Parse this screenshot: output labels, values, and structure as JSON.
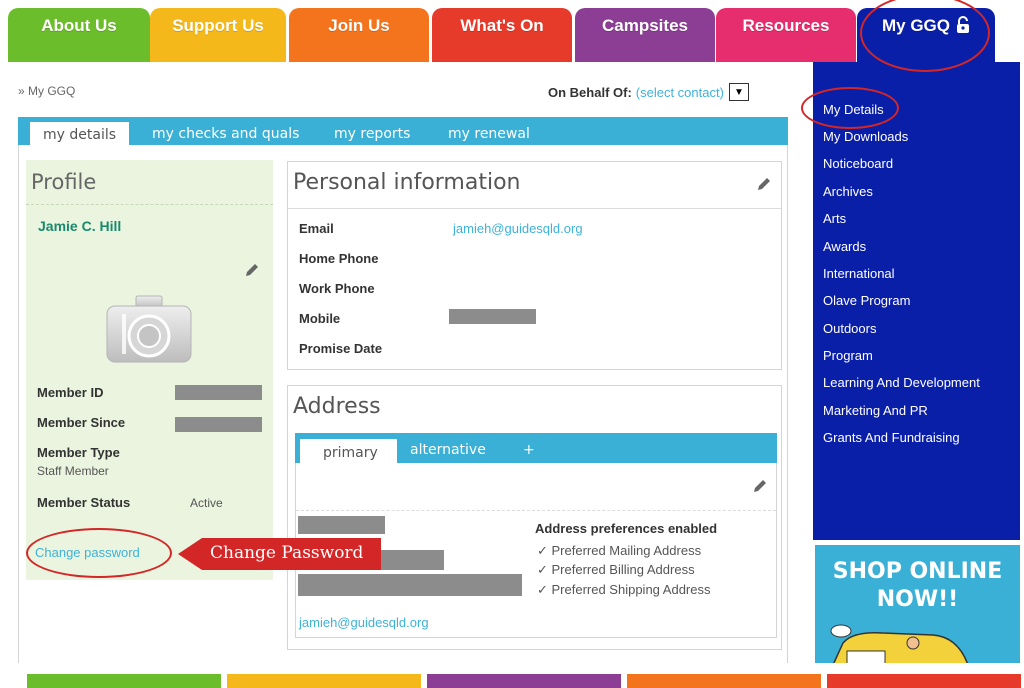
{
  "topnav": {
    "tabs": [
      {
        "label": "About Us",
        "color": "#6cbd2c"
      },
      {
        "label": "Support Us",
        "color": "#f5b81b"
      },
      {
        "label": "Join Us",
        "color": "#f3741d"
      },
      {
        "label": "What's On",
        "color": "#e63a2b"
      },
      {
        "label": "Campsites",
        "color": "#8b3e93"
      },
      {
        "label": "Resources",
        "color": "#e62d6d"
      },
      {
        "label": "My GGQ",
        "color": "#0a1fa8",
        "icon": "unlock-icon"
      }
    ]
  },
  "breadcrumb": "» My GGQ",
  "behalf": {
    "label": "On Behalf Of:",
    "link": "(select contact)"
  },
  "main_tabs": [
    "my details",
    "my checks and quals",
    "my reports",
    "my renewal"
  ],
  "profile": {
    "heading": "Profile",
    "name": "Jamie C. Hill",
    "fields": {
      "member_id": "Member ID",
      "member_since": "Member Since",
      "member_type": "Member Type",
      "member_type_value": "Staff Member",
      "member_status": "Member Status",
      "member_status_value": "Active"
    },
    "change_password": "Change password"
  },
  "personal": {
    "heading": "Personal information",
    "email_label": "Email",
    "email_value": "jamieh@guidesqld.org",
    "home_phone": "Home Phone",
    "work_phone": "Work Phone",
    "mobile": "Mobile",
    "promise_date": "Promise Date"
  },
  "address": {
    "heading": "Address",
    "tabs": [
      "primary",
      "alternative",
      "+"
    ],
    "prefs_title": "Address preferences enabled",
    "prefs": [
      "✓ Preferred Mailing Address",
      "✓ Preferred Billing Address",
      "✓ Preferred Shipping Address"
    ],
    "email": "jamieh@guidesqld.org"
  },
  "sidebar": {
    "items": [
      "My Details",
      "My Downloads",
      "Noticeboard",
      "Archives",
      "Arts",
      "Awards",
      "International",
      "Olave Program",
      "Outdoors",
      "Program",
      "Learning And Development",
      "Marketing And PR",
      "Grants And Fundraising"
    ]
  },
  "shop": {
    "line1": "SHOP ONLINE",
    "line2": "NOW!!"
  },
  "callout": "Change Password",
  "colors": {
    "accent": "#3ab0d6",
    "sidebar": "#0a1fa8",
    "annotation": "#d32626"
  }
}
